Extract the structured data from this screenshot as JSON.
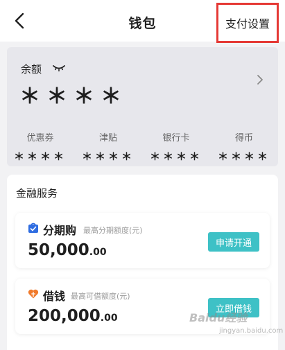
{
  "header": {
    "title": "钱包",
    "settings_label": "支付设置",
    "highlight_color": "#e53935"
  },
  "wallet": {
    "balance_label": "余额",
    "balance_value": "＊＊＊＊",
    "stats": [
      {
        "label": "优惠券",
        "value": "＊＊＊＊"
      },
      {
        "label": "津贴",
        "value": "＊＊＊＊"
      },
      {
        "label": "银行卡",
        "value": "＊＊＊＊"
      },
      {
        "label": "得币",
        "value": "＊＊＊＊"
      }
    ]
  },
  "services": {
    "title": "金融服务",
    "items": [
      {
        "name": "分期购",
        "subtitle": "最高分期额度(元)",
        "amount_int": "50,000",
        "amount_dec": ".00",
        "button": "申请开通",
        "icon": "bag-icon",
        "icon_color": "#2f6de1"
      },
      {
        "name": "借钱",
        "subtitle": "最高可借额度(元)",
        "amount_int": "200,000",
        "amount_dec": ".00",
        "button": "立即借钱",
        "icon": "heart-icon",
        "icon_color": "#f07a2b"
      }
    ],
    "button_color": "#3ec1c6"
  },
  "watermark": {
    "text": "Baidu经验",
    "sub": "jingyan.baidu.com"
  }
}
